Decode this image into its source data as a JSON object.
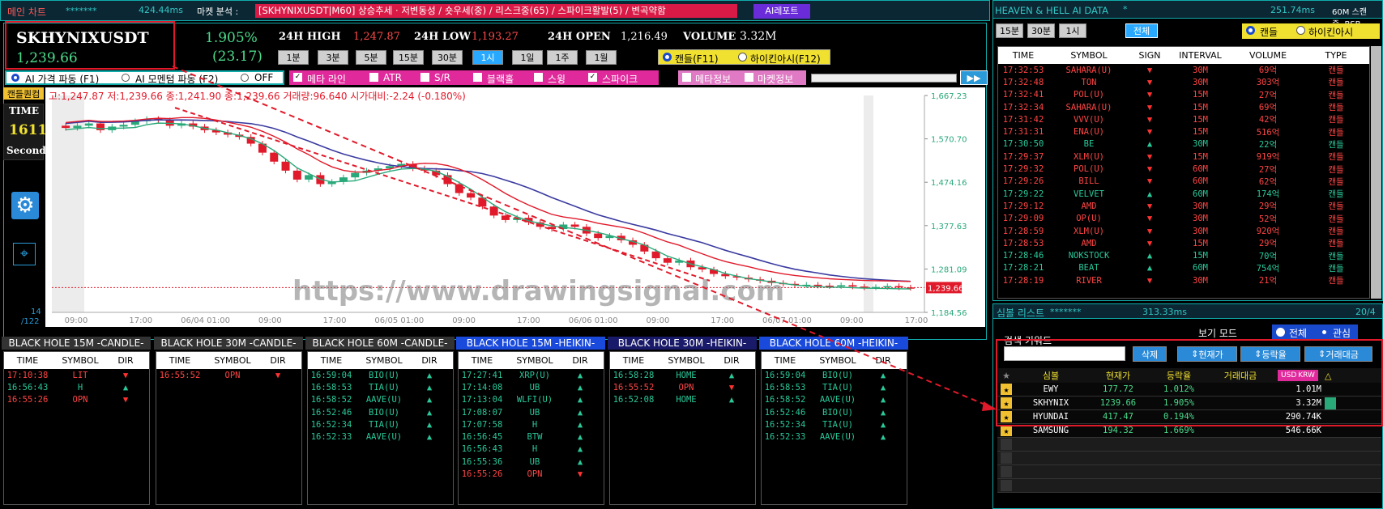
{
  "top": {
    "title": "메인 차트",
    "dots": "*******",
    "latency": "424.44ms",
    "analysis_label": "마켓 분석 :",
    "analysis_text": "[SKHYNIXUSDT|M60] 상승추세 · 저변동성 / 숏우세(중) / 리스크중(65) / 스파이크활발(5) / 변곡약함",
    "ai_report": "AI레포트"
  },
  "ticker": {
    "symbol": "SKHYNIXUSDT",
    "price": "1,239.66",
    "pct": "1.905%",
    "change": "(23.17)"
  },
  "stats": {
    "high_label": "24H HIGH",
    "high": "1,247.87",
    "low_label": "24H LOW",
    "low": "1,193.27",
    "open_label": "24H OPEN",
    "open": "1,216.49",
    "vol_label": "VOLUME",
    "vol": "3.32M"
  },
  "intervals": [
    "1분",
    "3분",
    "5분",
    "15분",
    "30분",
    "1시",
    "1일",
    "1주",
    "1월"
  ],
  "candle_mode": {
    "candle": "캔들(F11)",
    "heikin": "하이킨아시(F12)"
  },
  "toggles": {
    "f1": "AI 가격 파동 (F1)",
    "f2": "AI 모멘텀 파동 (F2)",
    "off": "OFF",
    "meta_line": "메타 라인",
    "atr": "ATR",
    "sr": "S/R",
    "black_hole": "블랙홀",
    "swing": "스윙",
    "spike": "스파이크",
    "meta_info": "메타정보",
    "market_info": "마켓정보",
    "play": "▶▶"
  },
  "chart_side": {
    "candle_label": "캔들퀀컴",
    "time_label": "TIME",
    "time_value": "1611",
    "second": "Second",
    "count1": "14",
    "count2": "/122"
  },
  "ohlc_line": "고:1,247.87  저:1,239.66  종:1,241.90  종:1,239.66  거래량:96.640  시가대비:-2.24 (-0.180%)",
  "watermark": "https://www.drawingsignal.com",
  "chart_data": {
    "type": "candlestick",
    "y_ticks": [
      "1,667.23",
      "1,570.70",
      "1,474.16",
      "1,377.63",
      "1,281.09",
      "1,184.56"
    ],
    "last_price": "1,239.66",
    "x_ticks": [
      "09:00",
      "17:00",
      "06/04 01:00",
      "09:00",
      "17:00",
      "06/05 01:00",
      "09:00",
      "17:00",
      "06/06 01:00",
      "09:00",
      "17:00",
      "06/07 01:00",
      "09:00",
      "17:00"
    ],
    "ylim": [
      1184.56,
      1667.23
    ],
    "closes": [
      1595,
      1600,
      1605,
      1590,
      1598,
      1602,
      1610,
      1615,
      1612,
      1600,
      1605,
      1598,
      1590,
      1585,
      1580,
      1575,
      1560,
      1540,
      1520,
      1500,
      1480,
      1490,
      1470,
      1475,
      1485,
      1495,
      1500,
      1505,
      1510,
      1515,
      1505,
      1500,
      1490,
      1470,
      1450,
      1440,
      1420,
      1400,
      1390,
      1395,
      1385,
      1375,
      1370,
      1380,
      1375,
      1360,
      1350,
      1355,
      1345,
      1335,
      1320,
      1305,
      1295,
      1300,
      1285,
      1280,
      1270,
      1265,
      1262,
      1258,
      1255,
      1250,
      1248,
      1245,
      1246,
      1244,
      1243,
      1245,
      1242,
      1240,
      1241,
      1243,
      1240,
      1239
    ]
  },
  "heaven": {
    "title": "HEAVEN & HELL AI DATA",
    "star": "*",
    "latency": "251.74ms",
    "status": "60M 스캔중..BSB",
    "tabs": [
      "15분",
      "30분",
      "1시",
      "전체"
    ],
    "candle": "캔들",
    "heikin": "하이킨아시",
    "headers": [
      "TIME",
      "SYMBOL",
      "SIGN",
      "INTERVAL",
      "VOLUME",
      "TYPE"
    ],
    "rows": [
      [
        "17:32:53",
        "SAHARA(U)",
        "dn",
        "30M",
        "69억",
        "캔들"
      ],
      [
        "17:32:48",
        "TON",
        "dn",
        "30M",
        "303억",
        "캔들"
      ],
      [
        "17:32:41",
        "POL(U)",
        "dn",
        "15M",
        "27억",
        "캔들"
      ],
      [
        "17:32:34",
        "SAHARA(U)",
        "dn",
        "15M",
        "69억",
        "캔들"
      ],
      [
        "17:31:42",
        "VVV(U)",
        "dn",
        "15M",
        "42억",
        "캔들"
      ],
      [
        "17:31:31",
        "ENA(U)",
        "dn",
        "15M",
        "516억",
        "캔들"
      ],
      [
        "17:30:50",
        "BE",
        "up",
        "30M",
        "22억",
        "캔들"
      ],
      [
        "17:29:37",
        "XLM(U)",
        "dn",
        "15M",
        "919억",
        "캔들"
      ],
      [
        "17:29:32",
        "POL(U)",
        "dn",
        "60M",
        "27억",
        "캔들"
      ],
      [
        "17:29:26",
        "BILL",
        "dn",
        "60M",
        "62억",
        "캔들"
      ],
      [
        "17:29:22",
        "VELVET",
        "up",
        "60M",
        "174억",
        "캔들"
      ],
      [
        "17:29:12",
        "AMD",
        "dn",
        "30M",
        "29억",
        "캔들"
      ],
      [
        "17:29:09",
        "OP(U)",
        "dn",
        "30M",
        "52억",
        "캔들"
      ],
      [
        "17:28:59",
        "XLM(U)",
        "dn",
        "30M",
        "920억",
        "캔들"
      ],
      [
        "17:28:53",
        "AMD",
        "dn",
        "15M",
        "29억",
        "캔들"
      ],
      [
        "17:28:46",
        "NOKSTOCK",
        "up",
        "15M",
        "70억",
        "캔들"
      ],
      [
        "17:28:21",
        "BEAT",
        "up",
        "60M",
        "754억",
        "캔들"
      ],
      [
        "17:28:19",
        "RIVER",
        "dn",
        "30M",
        "21억",
        "캔들"
      ]
    ]
  },
  "symbols": {
    "title": "심볼 리스트",
    "dots": "*******",
    "latency": "313.33ms",
    "page": "20/4",
    "view_label": "보기 모드",
    "view_all": "전체",
    "view_fav": "관심",
    "search_label": "검색 키워드",
    "search_value": "",
    "delete": "삭제",
    "sort_price": "현재가",
    "sort_pct": "등락율",
    "sort_vol": "거래대금",
    "headers": [
      "★",
      "심볼",
      "현재가",
      "등락율",
      "거래대금"
    ],
    "usd": "USD",
    "krw": "KRW",
    "rows": [
      [
        "EWY",
        "177.72",
        "1.012%",
        "1.01M"
      ],
      [
        "SKHYNIX",
        "1239.66",
        "1.905%",
        "3.32M"
      ],
      [
        "HYUNDAI",
        "417.47",
        "0.194%",
        "290.74K"
      ],
      [
        "SAMSUNG",
        "194.32",
        "1.669%",
        "546.66K"
      ]
    ]
  },
  "blackholes": [
    {
      "title": "BLACK HOLE 15M -CANDLE-",
      "rows": [
        [
          "17:10:38",
          "LIT",
          "dn"
        ],
        [
          "16:56:43",
          "H",
          "up"
        ],
        [
          "16:55:26",
          "OPN",
          "dn"
        ]
      ]
    },
    {
      "title": "BLACK HOLE 30M -CANDLE-",
      "rows": [
        [
          "16:55:52",
          "OPN",
          "dn"
        ]
      ]
    },
    {
      "title": "BLACK HOLE 60M -CANDLE-",
      "rows": [
        [
          "16:59:04",
          "BIO(U)",
          "up"
        ],
        [
          "16:58:53",
          "TIA(U)",
          "up"
        ],
        [
          "16:58:52",
          "AAVE(U)",
          "up"
        ],
        [
          "16:52:46",
          "BIO(U)",
          "up"
        ],
        [
          "16:52:34",
          "TIA(U)",
          "up"
        ],
        [
          "16:52:33",
          "AAVE(U)",
          "up"
        ]
      ]
    },
    {
      "title": "BLACK HOLE 15M -HEIKIN-",
      "rows": [
        [
          "17:27:41",
          "XRP(U)",
          "up"
        ],
        [
          "17:14:08",
          "UB",
          "up"
        ],
        [
          "17:13:04",
          "WLFI(U)",
          "up"
        ],
        [
          "17:08:07",
          "UB",
          "up"
        ],
        [
          "17:07:58",
          "H",
          "up"
        ],
        [
          "16:56:45",
          "BTW",
          "up"
        ],
        [
          "16:56:43",
          "H",
          "up"
        ],
        [
          "16:55:36",
          "UB",
          "up"
        ],
        [
          "16:55:26",
          "OPN",
          "dn"
        ]
      ]
    },
    {
      "title": "BLACK HOLE 30M -HEIKIN-",
      "rows": [
        [
          "16:58:28",
          "HOME",
          "up"
        ],
        [
          "16:55:52",
          "OPN",
          "dn"
        ],
        [
          "16:52:08",
          "HOME",
          "up"
        ]
      ]
    },
    {
      "title": "BLACK HOLE 60M -HEIKIN-",
      "rows": [
        [
          "16:59:04",
          "BIO(U)",
          "up"
        ],
        [
          "16:58:53",
          "TIA(U)",
          "up"
        ],
        [
          "16:58:52",
          "AAVE(U)",
          "up"
        ],
        [
          "16:52:46",
          "BIO(U)",
          "up"
        ],
        [
          "16:52:34",
          "TIA(U)",
          "up"
        ],
        [
          "16:52:33",
          "AAVE(U)",
          "up"
        ]
      ]
    }
  ],
  "bh_headers": [
    "TIME",
    "SYMBOL",
    "DIR"
  ]
}
